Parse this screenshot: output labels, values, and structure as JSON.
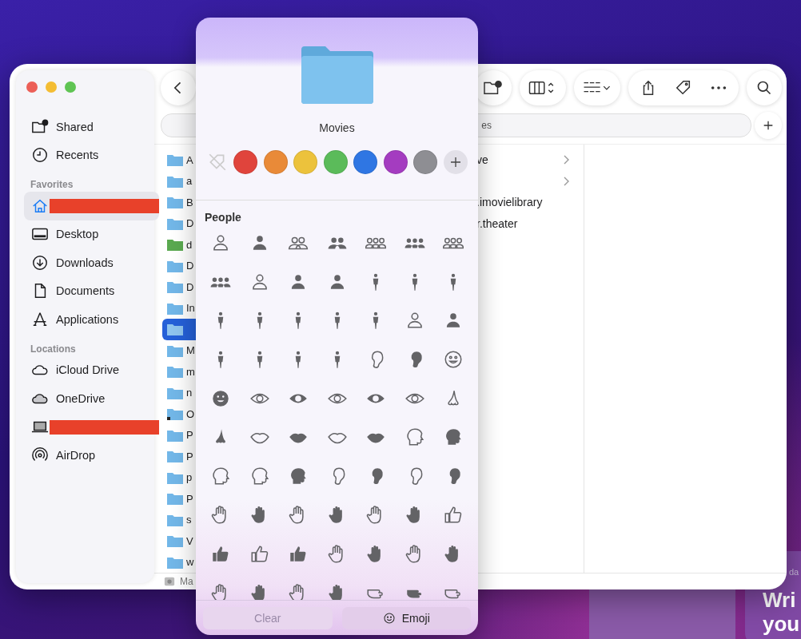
{
  "sidebar": {
    "sections": [
      {
        "items": [
          {
            "label": "Shared",
            "selected": false
          },
          {
            "label": "Recents",
            "selected": false
          }
        ]
      },
      {
        "heading": "Favorites",
        "items": [
          {
            "redacted": true,
            "selected": true
          },
          {
            "label": "Desktop",
            "selected": false
          },
          {
            "label": "Downloads",
            "selected": false
          },
          {
            "label": "Documents",
            "selected": false
          },
          {
            "label": "Applications",
            "selected": false
          }
        ]
      },
      {
        "heading": "Locations",
        "items": [
          {
            "label": "iCloud Drive",
            "selected": false
          },
          {
            "label": "OneDrive",
            "selected": false
          },
          {
            "redacted": true,
            "selected": false
          },
          {
            "label": "AirDrop",
            "selected": false
          }
        ]
      }
    ]
  },
  "path_field": {
    "value": "es"
  },
  "file_column": [
    {
      "name": "A",
      "kind": "folder",
      "selected": false
    },
    {
      "name": "a",
      "kind": "folder",
      "selected": false
    },
    {
      "name": "B",
      "kind": "folder",
      "selected": false
    },
    {
      "name": "D",
      "kind": "folder",
      "selected": false
    },
    {
      "name": "d",
      "kind": "green-folder",
      "selected": false
    },
    {
      "name": "D",
      "kind": "folder",
      "selected": false
    },
    {
      "name": "D",
      "kind": "folder",
      "selected": false
    },
    {
      "name": "In",
      "kind": "folder",
      "selected": false
    },
    {
      "kind": "folder",
      "selected": true
    },
    {
      "name": "M",
      "kind": "folder",
      "selected": false
    },
    {
      "name": "m",
      "kind": "folder",
      "selected": false
    },
    {
      "name": "n",
      "kind": "folder",
      "selected": false
    },
    {
      "name": "O",
      "kind": "alias",
      "selected": false
    },
    {
      "name": "P",
      "kind": "folder",
      "selected": false
    },
    {
      "name": "P",
      "kind": "folder",
      "selected": false
    },
    {
      "name": "p",
      "kind": "folder",
      "selected": false
    },
    {
      "name": "P",
      "kind": "folder",
      "selected": false
    },
    {
      "name": "s",
      "kind": "folder",
      "selected": false
    },
    {
      "name": "V",
      "kind": "folder",
      "selected": false
    },
    {
      "name": "w",
      "kind": "folder",
      "selected": false
    }
  ],
  "second_column": [
    {
      "name": "ve",
      "chevron": true
    },
    {
      "chevron": true
    },
    {
      "name": ".imovielibrary",
      "chevron": false
    },
    {
      "name": "r.theater",
      "chevron": false
    }
  ],
  "path_bar": {
    "text": "Ma"
  },
  "popover": {
    "folder_name": "Movies",
    "tags": [
      {
        "color": "#e0443c"
      },
      {
        "color": "#e98a38"
      },
      {
        "color": "#ecc23c"
      },
      {
        "color": "#5bbb5a"
      },
      {
        "color": "#2f76e3"
      },
      {
        "color": "#a43cc0"
      },
      {
        "color": "#8e8e93"
      }
    ],
    "section": "People",
    "buttons": [
      {
        "label": "Clear",
        "disabled": true
      },
      {
        "label": "Emoji",
        "disabled": false
      }
    ]
  },
  "widget": {
    "texts": [
      "da",
      "Wri",
      "you"
    ]
  }
}
